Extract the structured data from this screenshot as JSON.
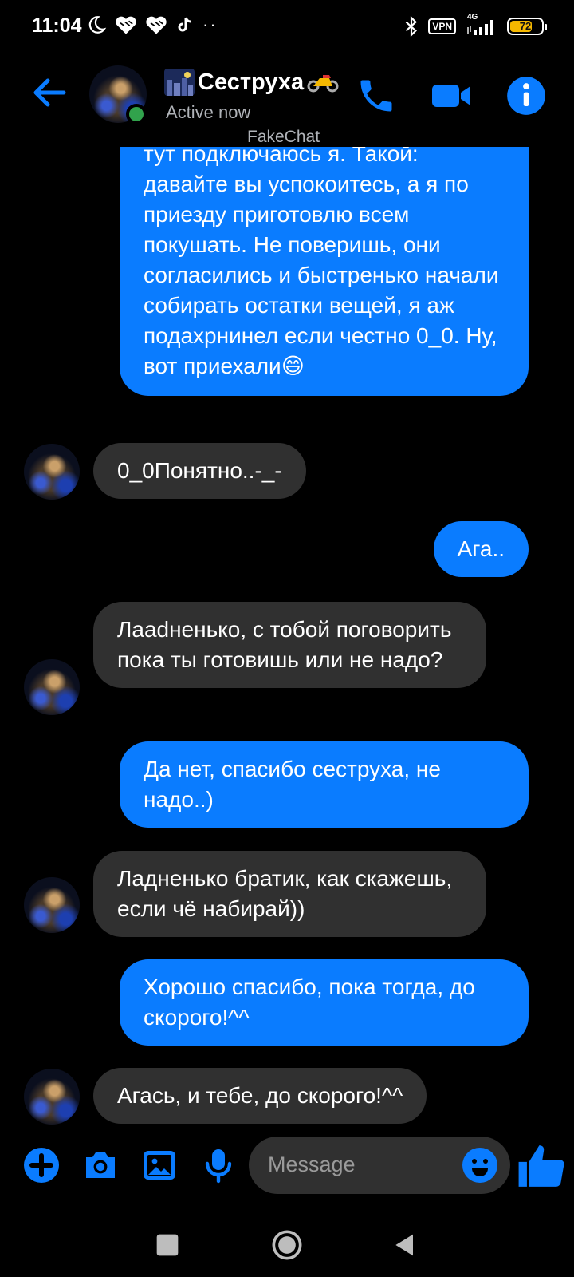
{
  "status_bar": {
    "time": "11:04",
    "vpn": "VPN",
    "network": "4G",
    "battery": "72",
    "battery_level": 0.72
  },
  "header": {
    "contact_name": "Сеструха",
    "status": "Active now",
    "watermark": "FakeChat"
  },
  "colors": {
    "accent": "#0a7cff",
    "incoming_bubble": "#303030",
    "online": "#31a24c",
    "battery": "#f5b800"
  },
  "messages": [
    {
      "dir": "out",
      "text": "тут подключаюсь я. Такой: давайте вы успокоитесь, а я по приезду приготовлю всем покушать. Не поверишь, они согласились и быстренько начали собирать остатки вещей, я аж подахрнинел если честно 0_0. Ну, вот приехали😄"
    },
    {
      "dir": "in",
      "text": "0_0Понятно..-_-"
    },
    {
      "dir": "out",
      "text": "Ага.."
    },
    {
      "dir": "in",
      "text": "Лааdненько, с тобой поговорить пока ты готовишь или не надо?"
    },
    {
      "dir": "out",
      "text": "Да нет, спасибо сеструха, не надо..)"
    },
    {
      "dir": "in",
      "text": "Ладненько братик, как скажешь, если чё набирай))"
    },
    {
      "dir": "out",
      "text": "Хорошо спасибо, пока тогда, до скорого!^^"
    },
    {
      "dir": "in",
      "text": "Агась, и тебе, до скорого!^^"
    }
  ],
  "composer": {
    "placeholder": "Message"
  },
  "icons": {
    "back": "arrow-left-icon",
    "call": "phone-icon",
    "video": "video-camera-icon",
    "info": "info-icon",
    "plus": "plus-icon",
    "camera": "camera-icon",
    "gallery": "image-icon",
    "mic": "microphone-icon",
    "emoji": "emoji-icon",
    "like": "thumbs-up-icon"
  }
}
